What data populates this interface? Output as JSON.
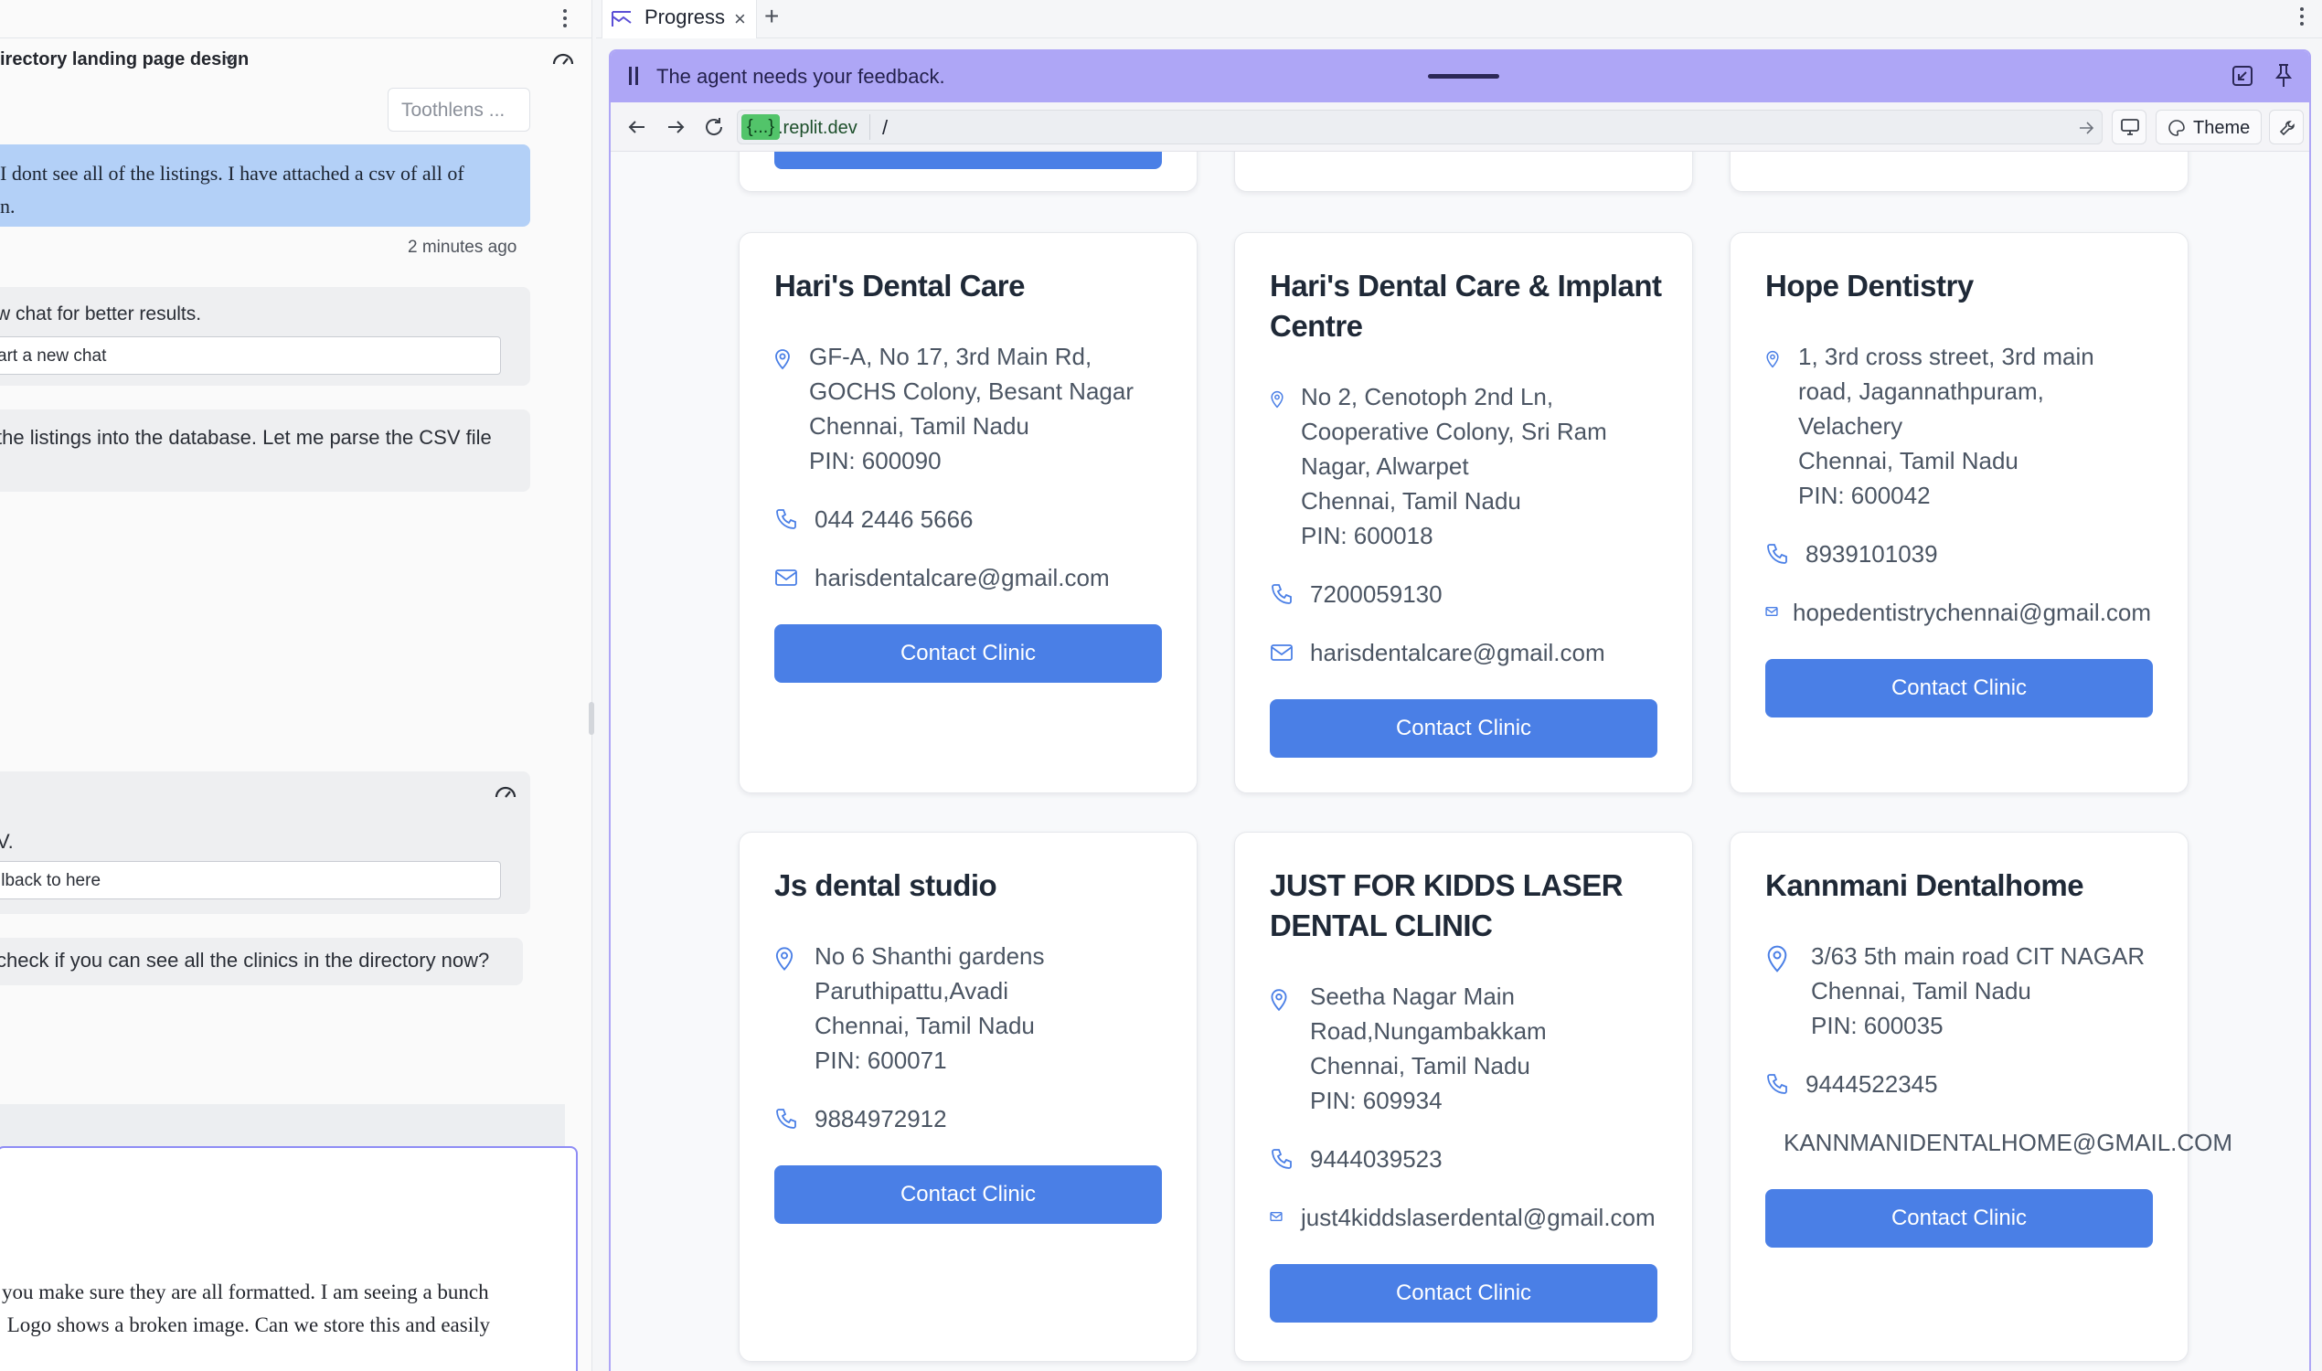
{
  "chat": {
    "title": "irectory landing page design",
    "toothlens_label": "Toothlens ...",
    "user_message_1": "I dont see all of the listings. I have attached a csv of all of\nn.",
    "message_time": "2 minutes ago",
    "system_1_text": "w chat for better results.",
    "new_chat_button": "art a new chat",
    "agent_message_1": " the listings into the database. Let me parse the CSV file",
    "system_2_text": "V.",
    "rollback_button": "llback to here",
    "agent_message_2": " check if you can see all the clinics in the directory now?",
    "composer_text": "you make sure they are all formatted. I am seeing a bunch\n Logo shows a broken image. Can we store this and easily"
  },
  "tabs": {
    "active_label": "Progress",
    "close_glyph": "×",
    "add_glyph": "+"
  },
  "feedback": {
    "message": "The agent needs your feedback."
  },
  "browser": {
    "host_badge": "{...}",
    "host_domain": ".replit.dev",
    "path": "/",
    "theme_label": "Theme"
  },
  "clinics": [
    {
      "name": "Hari's Dental Care",
      "address": [
        "GF-A, No 17, 3rd Main Rd,",
        "GOCHS Colony, Besant Nagar",
        "Chennai, Tamil Nadu",
        "PIN: 600090"
      ],
      "phone": "044 2446 5666",
      "email": "harisdentalcare@gmail.com",
      "button": "Contact Clinic"
    },
    {
      "name": "Hari's Dental Care & Implant Centre",
      "address": [
        "No 2, Cenotoph 2nd Ln,",
        "Cooperative Colony, Sri Ram",
        "Nagar, Alwarpet",
        "Chennai, Tamil Nadu",
        "PIN: 600018"
      ],
      "phone": "7200059130",
      "email": "harisdentalcare@gmail.com",
      "button": "Contact Clinic"
    },
    {
      "name": "Hope Dentistry",
      "address": [
        "1, 3rd cross street, 3rd main",
        "road, Jagannathpuram,",
        "Velachery",
        "Chennai, Tamil Nadu",
        "PIN: 600042"
      ],
      "phone": "8939101039",
      "email": "hopedentistrychennai@gmail.com",
      "button": "Contact Clinic"
    },
    {
      "name": "Js dental studio",
      "address": [
        "No 6 Shanthi gardens",
        "Paruthipattu,Avadi",
        "Chennai, Tamil Nadu",
        "PIN: 600071"
      ],
      "phone": "9884972912",
      "email": "",
      "button": "Contact Clinic"
    },
    {
      "name": "JUST FOR KIDDS LASER DENTAL CLINIC",
      "address": [
        "Seetha Nagar Main",
        "Road,Nungambakkam",
        "Chennai, Tamil Nadu",
        "PIN: 609934"
      ],
      "phone": "9444039523",
      "email": "just4kiddslaserdental@gmail.com",
      "button": "Contact Clinic"
    },
    {
      "name": "Kannmani Dentalhome",
      "address": [
        "3/63 5th main road CIT NAGAR",
        "Chennai, Tamil Nadu",
        "PIN: 600035"
      ],
      "phone": "9444522345",
      "email": "KANNMANIDENTALHOME@GMAIL.COM",
      "button": "Contact Clinic"
    }
  ],
  "colors": {
    "accent": "#4a7fe6",
    "feedback_bar": "#aea6f6",
    "user_bubble": "#b3d0f7",
    "url_badge": "#52c46a"
  },
  "icons": {
    "location": "map-pin-icon",
    "phone": "phone-icon",
    "email": "mail-icon"
  }
}
